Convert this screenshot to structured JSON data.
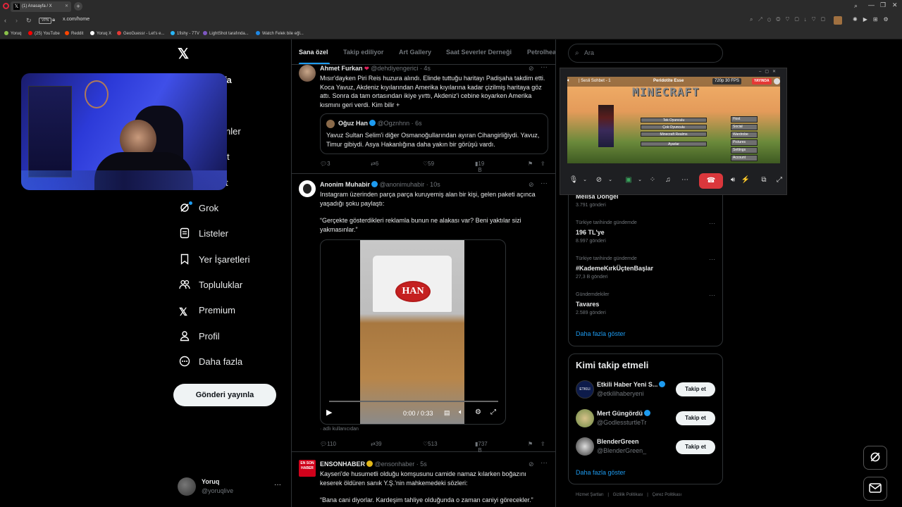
{
  "browser": {
    "tab_title": "(1) Anasayfa / X",
    "vpn_label": "VPN",
    "url": "x.com/home"
  },
  "bookmarks": [
    {
      "label": "Yoruq",
      "color": "#8bc34a"
    },
    {
      "label": "(25) YouTube",
      "color": "#ff0000"
    },
    {
      "label": "Reddit",
      "color": "#ff4500"
    },
    {
      "label": "Yoruq X",
      "color": "#ffffff"
    },
    {
      "label": "GeoGuessr - Let's e...",
      "color": "#e53935"
    },
    {
      "label": "1fishy - 7TV",
      "color": "#29b6f6"
    },
    {
      "label": "LightShot tarafında...",
      "color": "#7e57c2"
    },
    {
      "label": "Watch Felek bile eğl...",
      "color": "#1e88e5"
    }
  ],
  "nav": {
    "partial_home": "yfa",
    "partial_1": "nler",
    "partial_2": "t",
    "partial_3": "t",
    "items": [
      {
        "label": "Grok",
        "icon": "grok-icon"
      },
      {
        "label": "Listeler",
        "icon": "list-icon"
      },
      {
        "label": "Yer İşaretleri",
        "icon": "bookmark-icon"
      },
      {
        "label": "Topluluklar",
        "icon": "communities-icon"
      },
      {
        "label": "Premium",
        "icon": "x-logo-icon"
      },
      {
        "label": "Profil",
        "icon": "person-icon"
      },
      {
        "label": "Daha fazla",
        "icon": "more-circle-icon"
      }
    ],
    "post_button": "Gönderi yayınla",
    "account_name": "Yoruq",
    "account_handle": "@yoruqlive",
    "account_more": "···"
  },
  "timeline": {
    "tabs": [
      "Sana özel",
      "Takip ediliyor",
      "Art Gallery",
      "Saat Severler Derneği",
      "Petrolhea"
    ],
    "tweets": [
      {
        "name": "Ahmet Furkan",
        "handle": "@dehdiyengerici · 4s",
        "text": "Mısır'dayken Piri Reis huzura alındı. Elinde tuttuğu haritayı Padişaha takdim etti. Koca Yavuz, Akdeniz kıyılarından Amerika kıyılarına kadar çizilmiş haritaya göz attı. Sonra da tam ortasından ikiye yırttı, Akdeniz'i cebine koyarken Amerika kısmını geri verdi. Kim bilir +",
        "quote_name": "Oğuz Han",
        "quote_handle": "@Ogznhnn · 6s",
        "quote_text": "Yavuz Sultan Selim'i diğer Osmanoğullarından ayıran Cihangirliğiydi. Yavuz, Timur gibiydi. Asya Hakanlığına daha yakın bir görüşü vardı.",
        "replies": "3",
        "reposts": "6",
        "likes": "59",
        "views": "19 B"
      },
      {
        "name": "Anonim Muhabir",
        "handle": "@anonimuhabir · 10s",
        "text": "Instagram üzerinden parça parça kuruyemiş alan bir kişi, gelen paketi açınca yaşadığı şoku paylaştı:",
        "text2": "“Gerçekte gösterdikleri reklamla bunun ne alakası var? Beni yaktılar sizi yakmasınlar.”",
        "video_time": "0:00 / 0:33",
        "bag_label": "HAN",
        "video_source": "adlı kullanıcıdan",
        "replies": "110",
        "reposts": "39",
        "likes": "513",
        "views": "737 B"
      },
      {
        "name": "ENSONHABER",
        "handle": "@ensonhaber · 5s",
        "avatar_label": "EN SON HABER",
        "text": "Kayseri'de husumetli olduğu komşusunu camide namaz kılarken boğazını keserek öldüren sanık Y.Ş.'nin mahkemedeki sözleri:",
        "text2": "“Bana cani diyorlar. Kardeşim tahliye olduğunda o zaman caniyi görecekler.”"
      }
    ]
  },
  "right": {
    "search_placeholder": "Ara",
    "trends": [
      {
        "category": "",
        "title": "Melisa Döngel",
        "count": "3.791 gönderi"
      },
      {
        "category": "Türkiye tarihinde gündemde",
        "title": "196 TL'ye",
        "count": "8.997 gönderi"
      },
      {
        "category": "Türkiye tarihinde gündemde",
        "title": "#KademeKırkÜçtenBaşlar",
        "count": "27,3 B gönderi"
      },
      {
        "category": "Gündemdekiler",
        "title": "Tavares",
        "count": "2.589 gönderi"
      }
    ],
    "show_more": "Daha fazla göster",
    "who_title": "Kimi takip etmeli",
    "who": [
      {
        "name": "Etkili Haber Yeni S...",
        "handle": "@etkilihaberyeni",
        "button": "Takip et"
      },
      {
        "name": "Mert Güngördü",
        "handle": "@GodlessturtleTr",
        "button": "Takip et"
      },
      {
        "name": "BlenderGreen",
        "handle": "@BlenderGreen_",
        "button": "Takip et"
      }
    ],
    "who_more": "Daha fazla göster",
    "footer": [
      "Hizmet Şartları",
      "Gizlilik Politikası",
      "Çerez Politikası"
    ]
  },
  "discord": {
    "channel": "Sesli Sohbet - 1",
    "stream_title": "Peridotite Esse",
    "quality": "720p 30 FPS",
    "live_badge": "YAYINDA",
    "game_logo": "MINECRAFT",
    "menu_buttons": [
      "Tek Oyunculu",
      "Çok Oyunculu",
      "Minecraft Realms",
      "Ayarlar"
    ],
    "side_buttons": [
      "Host",
      "Social",
      "Wardrobe",
      "Pictures",
      "Settings",
      "Account"
    ]
  }
}
